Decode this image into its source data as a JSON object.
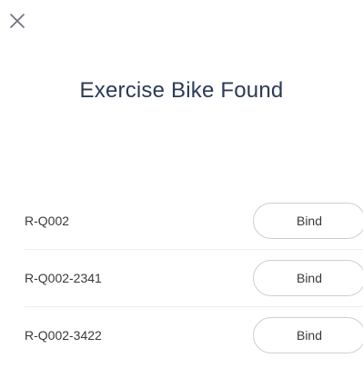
{
  "header": {
    "close_icon": "close-icon",
    "title": "Exercise Bike Found"
  },
  "devices": [
    {
      "name": "R-Q002",
      "action_label": "Bind"
    },
    {
      "name": "R-Q002-2341",
      "action_label": "Bind"
    },
    {
      "name": "R-Q002-3422",
      "action_label": "Bind"
    }
  ],
  "colors": {
    "title": "#2b3a57",
    "text": "#3a3a3a",
    "button_border": "#cfcfcf",
    "divider": "#eeeeee"
  }
}
